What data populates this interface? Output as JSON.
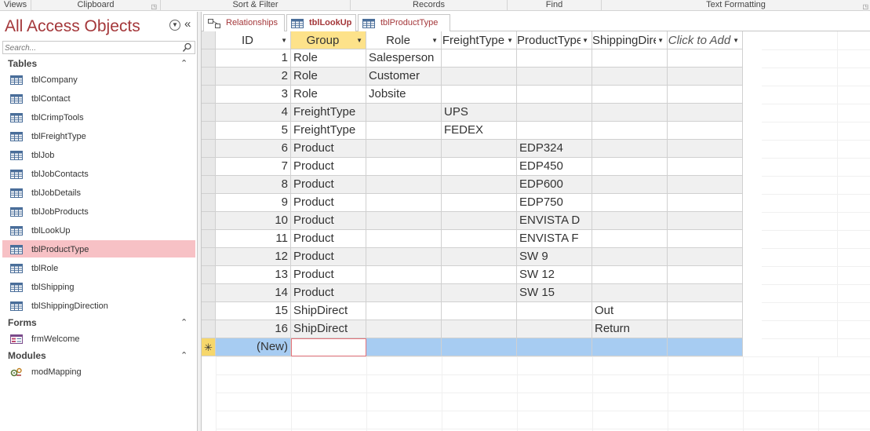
{
  "ribbon": {
    "groups": [
      "Views",
      "Clipboard",
      "Sort & Filter",
      "Records",
      "Find",
      "Text Formatting"
    ]
  },
  "nav": {
    "title": "All Access Objects",
    "search_placeholder": "Search...",
    "groups": {
      "tables": "Tables",
      "forms": "Forms",
      "modules": "Modules"
    },
    "tables": [
      "tblCompany",
      "tblContact",
      "tblCrimpTools",
      "tblFreightType",
      "tblJob",
      "tblJobContacts",
      "tblJobDetails",
      "tblJobProducts",
      "tblLookUp",
      "tblProductType",
      "tblRole",
      "tblShipping",
      "tblShippingDirection"
    ],
    "forms": [
      "frmWelcome"
    ],
    "modules": [
      "modMapping"
    ],
    "selected": "tblProductType"
  },
  "tabs": [
    "Relationships",
    "tblLookUp",
    "tblProductType"
  ],
  "active_tab": "tblLookUp",
  "sheet": {
    "columns": [
      "ID",
      "Group",
      "Role",
      "FreightType",
      "ProductType",
      "ShippingDirection",
      "Click to Add"
    ],
    "rows": [
      [
        "1",
        "Role",
        "Salesperson",
        "",
        "",
        ""
      ],
      [
        "2",
        "Role",
        "Customer",
        "",
        "",
        ""
      ],
      [
        "3",
        "Role",
        "Jobsite",
        "",
        "",
        ""
      ],
      [
        "4",
        "FreightType",
        "",
        "UPS",
        "",
        ""
      ],
      [
        "5",
        "FreightType",
        "",
        "FEDEX",
        "",
        ""
      ],
      [
        "6",
        "Product",
        "",
        "",
        "EDP324",
        ""
      ],
      [
        "7",
        "Product",
        "",
        "",
        "EDP450",
        ""
      ],
      [
        "8",
        "Product",
        "",
        "",
        "EDP600",
        ""
      ],
      [
        "9",
        "Product",
        "",
        "",
        "EDP750",
        ""
      ],
      [
        "10",
        "Product",
        "",
        "",
        "ENVISTA D",
        ""
      ],
      [
        "11",
        "Product",
        "",
        "",
        "ENVISTA F",
        ""
      ],
      [
        "12",
        "Product",
        "",
        "",
        "SW 9",
        ""
      ],
      [
        "13",
        "Product",
        "",
        "",
        "SW 12",
        ""
      ],
      [
        "14",
        "Product",
        "",
        "",
        "SW 15",
        ""
      ],
      [
        "15",
        "ShipDirect",
        "",
        "",
        "",
        "Out"
      ],
      [
        "16",
        "ShipDirect",
        "",
        "",
        "",
        "Return"
      ]
    ],
    "new_row_label": "(New)",
    "new_row_marker": "✳"
  },
  "colors": {
    "accent": "#a4373a",
    "selected_nav": "#f7c1c5",
    "active_header": "#fde28a",
    "new_row": "#a7ccf2"
  }
}
